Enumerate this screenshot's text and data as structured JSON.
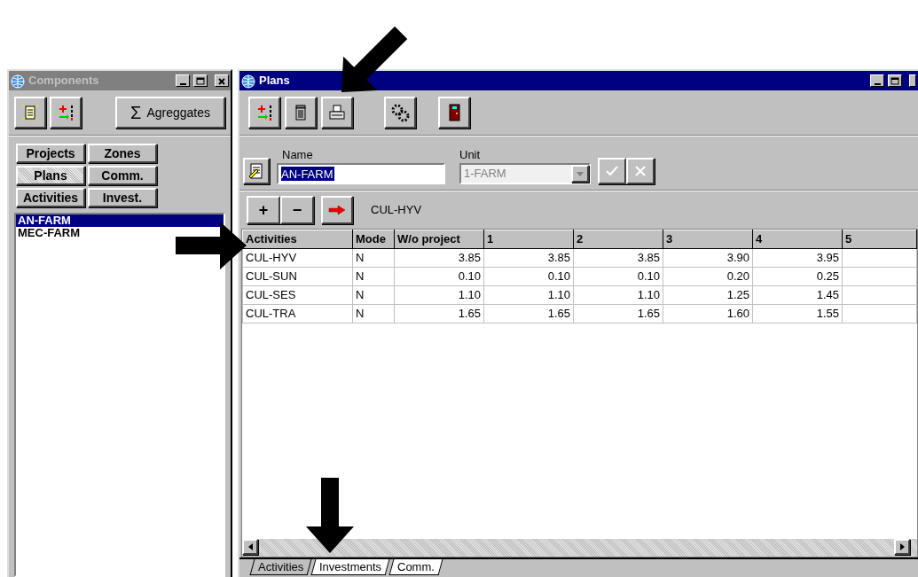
{
  "components": {
    "title": "Components",
    "toolbar": [
      {
        "kind": "new"
      },
      {
        "kind": "add"
      }
    ],
    "sigma": "Σ",
    "aggregates_button": "Agreggates",
    "filter_buttons": [
      {
        "label": "Projects",
        "selected": false
      },
      {
        "label": "Zones",
        "selected": false
      },
      {
        "label": "Plans",
        "selected": true
      },
      {
        "label": "Comm.",
        "selected": false
      },
      {
        "label": "Activities",
        "selected": false
      },
      {
        "label": "Invest.",
        "selected": false
      }
    ],
    "list": [
      {
        "label": "AN-FARM",
        "selected": true
      },
      {
        "label": "MEC-FARM",
        "selected": false
      }
    ]
  },
  "plans": {
    "title": "Plans",
    "toolbar": [
      {
        "kind": "add"
      },
      {
        "kind": "delete"
      },
      {
        "kind": "print"
      },
      {
        "kind": "gears"
      },
      {
        "kind": "exit"
      }
    ],
    "name_label": "Name",
    "name_value": "AN-FARM",
    "unit_label": "Unit",
    "unit_value": "1-FARM",
    "unit_disabled": true,
    "grid_buttons": [
      "+",
      "−"
    ],
    "current_activity": "CUL-HYV",
    "table": {
      "columns": [
        "Activities",
        "Mode",
        "W/o project",
        "1",
        "2",
        "3",
        "4",
        "5"
      ],
      "rows": [
        {
          "cells": [
            "CUL-HYV",
            "N",
            "3.85",
            "3.85",
            "3.85",
            "3.90",
            "3.95"
          ]
        },
        {
          "cells": [
            "CUL-SUN",
            "N",
            "0.10",
            "0.10",
            "0.10",
            "0.20",
            "0.25"
          ]
        },
        {
          "cells": [
            "CUL-SES",
            "N",
            "1.10",
            "1.10",
            "1.10",
            "1.25",
            "1.45"
          ]
        },
        {
          "cells": [
            "CUL-TRA",
            "N",
            "1.65",
            "1.65",
            "1.65",
            "1.60",
            "1.55"
          ]
        }
      ]
    },
    "tabs": [
      {
        "label": "Activities",
        "selected": true
      },
      {
        "label": "Investments",
        "selected": false
      },
      {
        "label": "Comm.",
        "selected": false
      }
    ]
  }
}
